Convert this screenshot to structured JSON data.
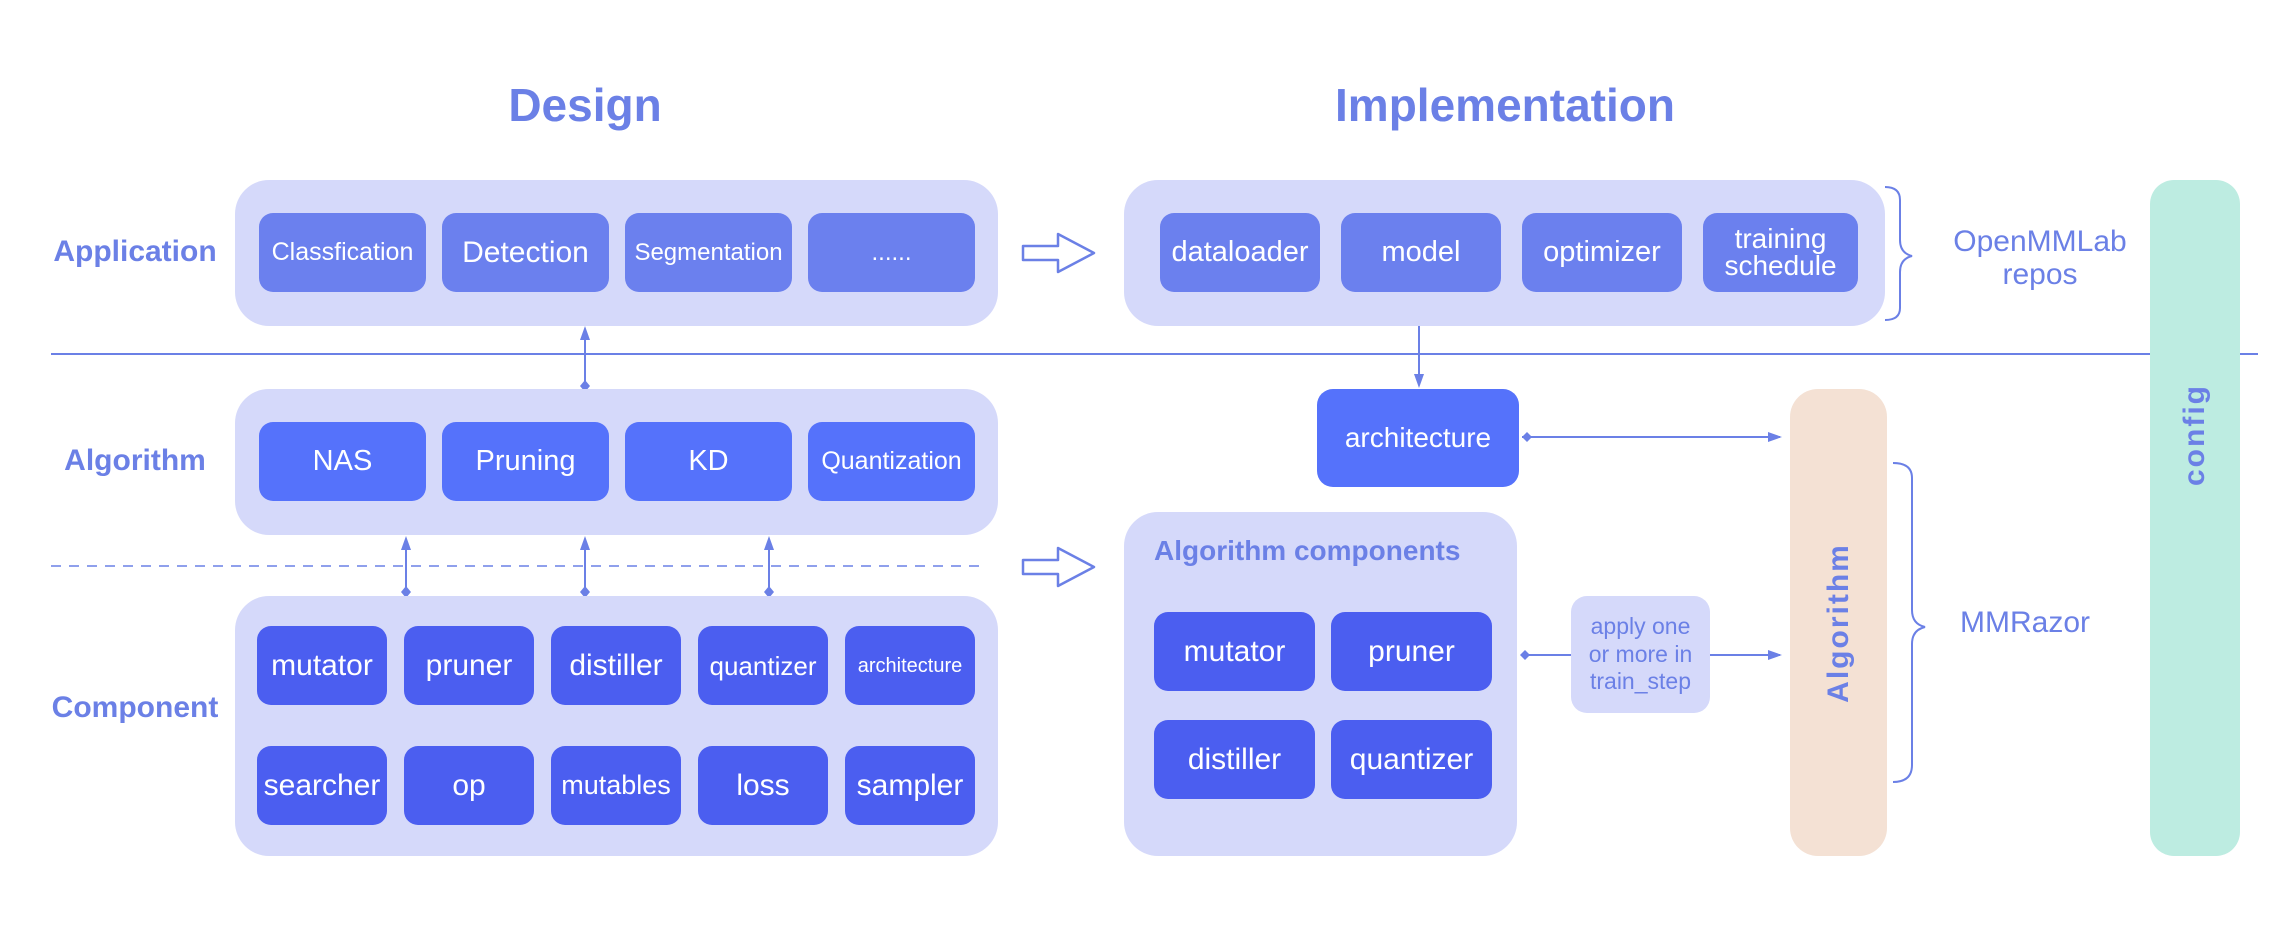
{
  "headers": {
    "design": "Design",
    "implementation": "Implementation"
  },
  "row_labels": {
    "application": "Application",
    "algorithm": "Algorithm",
    "component": "Component"
  },
  "design": {
    "application_items": [
      "Classfication",
      "Detection",
      "Segmentation",
      "......"
    ],
    "algorithm_items": [
      "NAS",
      "Pruning",
      "KD",
      "Quantization"
    ],
    "component_row1": [
      "mutator",
      "pruner",
      "distiller",
      "quantizer",
      "architecture"
    ],
    "component_row2": [
      "searcher",
      "op",
      "mutables",
      "loss",
      "sampler"
    ]
  },
  "implementation": {
    "repo_items": [
      "dataloader",
      "model",
      "optimizer",
      "training schedule"
    ],
    "repo_items_lines": [
      [
        "dataloader"
      ],
      [
        "model"
      ],
      [
        "optimizer"
      ],
      [
        "training",
        "schedule"
      ]
    ],
    "architecture": "architecture",
    "algorithm_components_title": "Algorithm components",
    "algorithm_components": [
      "mutator",
      "pruner",
      "distiller",
      "quantizer"
    ],
    "apply_note_lines": [
      "apply one",
      "or more in",
      "train_step"
    ],
    "algorithm_bar": "Algorithm",
    "config_bar": "config"
  },
  "brace_labels": {
    "openmmlab": [
      "OpenMMLab",
      "repos"
    ],
    "mmrazor": "MMRazor"
  },
  "colors": {
    "accent": "#6b80e6",
    "group_bg": "#d5d9fa",
    "app_box": "#6b80ee",
    "algorithm_box": "#5572fb",
    "component_box": "#4b5ef0",
    "algorithm_bar": "#f4e1d4",
    "config_bar": "#bdece1"
  }
}
